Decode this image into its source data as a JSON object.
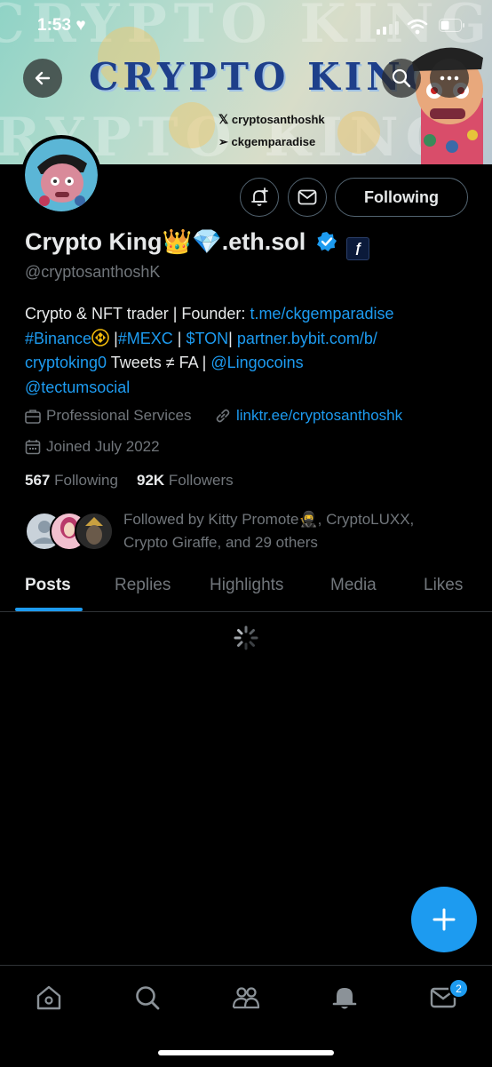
{
  "status_bar": {
    "time": "1:53",
    "battery_level": "35"
  },
  "banner": {
    "title": "CRYPTO KING",
    "watermark": "CRYPTO KING",
    "x_handle": "cryptosanthoshk",
    "telegram_handle": "ckgemparadise"
  },
  "top_actions": {
    "back": "back-arrow-icon",
    "search": "search-icon",
    "more": "more-icon"
  },
  "profile": {
    "display_name": "Crypto King👑💎.eth.sol",
    "handle": "@cryptosanthoshK",
    "following_button": "Following",
    "bio": {
      "line1_text": "Crypto & NFT trader | Founder: ",
      "line1_link": "t.me/ckgemparadise",
      "line2_tag1": "#Binance",
      "line2_sep1": " |",
      "line2_tag2": "#MEXC",
      "line2_sep2": " | ",
      "line2_tag3": "$TON",
      "line2_sep3": "| ",
      "line2_link": "partner.bybit.com/b/",
      "line3_link": "cryptoking0",
      "line3_text": " Tweets ≠ FA | ",
      "line3_mention": "@Lingocoins",
      "line4_mention": "@tectumsocial"
    },
    "category": "Professional Services",
    "website": "linktr.ee/cryptosanthoshk",
    "joined": "Joined July 2022",
    "following_count": "567",
    "following_label": "Following",
    "followers_count": "92K",
    "followers_label": "Followers",
    "followed_by_line1": "Followed by Kitty Promote🥷, CryptoLUXX,",
    "followed_by_line2": "Crypto Giraffe, and 29 others"
  },
  "tabs": [
    {
      "label": "Posts",
      "active": true
    },
    {
      "label": "Replies",
      "active": false
    },
    {
      "label": "Highlights",
      "active": false
    },
    {
      "label": "Media",
      "active": false
    },
    {
      "label": "Likes",
      "active": false
    }
  ],
  "bottom_nav": {
    "items": [
      "home-icon",
      "search-icon",
      "communities-icon",
      "notifications-icon",
      "messages-icon"
    ],
    "messages_badge": "2"
  },
  "colors": {
    "accent": "#1d9bf0",
    "background": "#000000",
    "secondary_text": "#71767b"
  }
}
